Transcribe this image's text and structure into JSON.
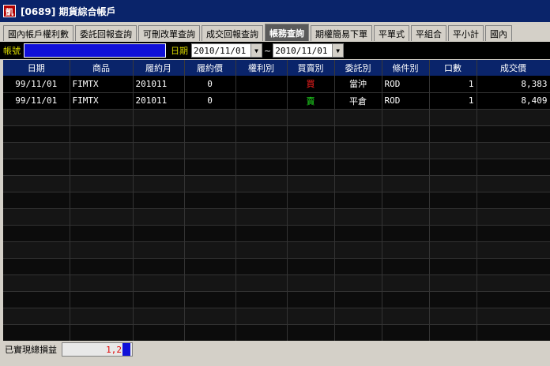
{
  "window": {
    "icon_text": "凱",
    "title": "[0689] 期貨綜合帳戶"
  },
  "tabs": [
    {
      "label": "國內帳戶權利數",
      "active": false
    },
    {
      "label": "委託回報查詢",
      "active": false
    },
    {
      "label": "可刪改單查詢",
      "active": false
    },
    {
      "label": "成交回報查詢",
      "active": false
    },
    {
      "label": "帳務查詢",
      "active": true
    },
    {
      "label": "期權簡易下單",
      "active": false
    },
    {
      "label": "平單式",
      "active": false
    },
    {
      "label": "平組合",
      "active": false
    },
    {
      "label": "平小計",
      "active": false
    },
    {
      "label": "國內",
      "active": false
    }
  ],
  "filter": {
    "account_label": "帳號",
    "date_label": "日期",
    "date_from": "2010/11/01",
    "date_to": "2010/11/01",
    "separator": "~"
  },
  "table": {
    "columns": [
      "日期",
      "商品",
      "履約月",
      "履約價",
      "權利別",
      "買賣別",
      "委託別",
      "條件別",
      "口數",
      "成交價"
    ],
    "rows": [
      {
        "date": "99/11/01",
        "product": "FIMTX",
        "month": "201011",
        "strike": "0",
        "right": "",
        "side": "買",
        "side_type": "buy",
        "order_type": "當沖",
        "cond": "ROD",
        "qty": "1",
        "price": "8,383"
      },
      {
        "date": "99/11/01",
        "product": "FIMTX",
        "month": "201011",
        "strike": "0",
        "right": "",
        "side": "賣",
        "side_type": "sell",
        "order_type": "平倉",
        "cond": "ROD",
        "qty": "1",
        "price": "8,409"
      }
    ]
  },
  "status": {
    "label": "已實現總損益",
    "value": "1,2"
  },
  "colors": {
    "title_bg": "#0a246a",
    "header_bg": "#0a246a",
    "buy": "#ff2020",
    "sell": "#20e020",
    "loss_value": "#e00000"
  }
}
